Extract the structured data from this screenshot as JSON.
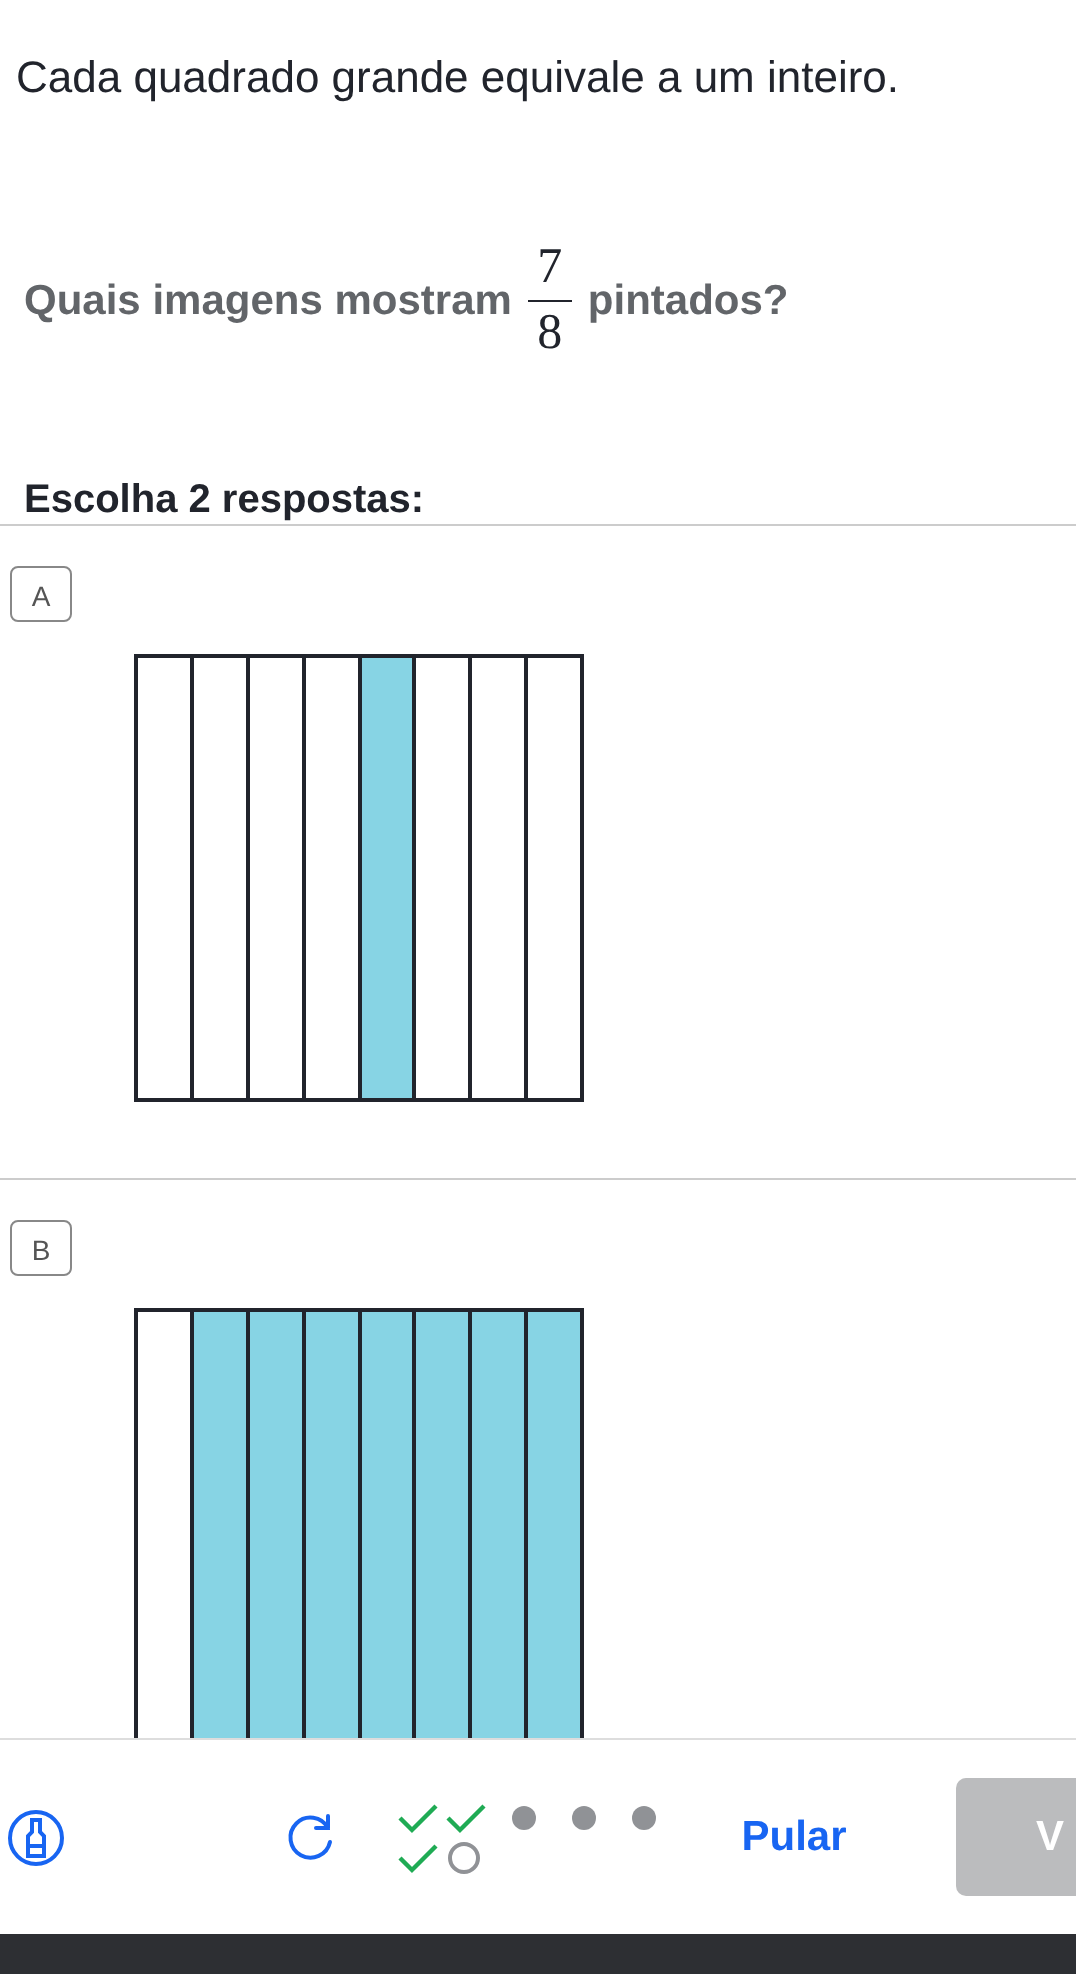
{
  "intro": "Cada quadrado grande equivale a um inteiro.",
  "question": {
    "before": "Quais imagens mostram",
    "numerator": "7",
    "denominator": "8",
    "after": "pintados?"
  },
  "instruction": "Escolha 2 respostas:",
  "options": [
    {
      "letter": "A",
      "columns": [
        {
          "shaded": false
        },
        {
          "shaded": false
        },
        {
          "shaded": false
        },
        {
          "shaded": false
        },
        {
          "shaded": true
        },
        {
          "shaded": false
        },
        {
          "shaded": false
        },
        {
          "shaded": false
        }
      ]
    },
    {
      "letter": "B",
      "columns": [
        {
          "shaded": false
        },
        {
          "shaded": true
        },
        {
          "shaded": true
        },
        {
          "shaded": true
        },
        {
          "shaded": true
        },
        {
          "shaded": true
        },
        {
          "shaded": true
        },
        {
          "shaded": true
        }
      ]
    }
  ],
  "progress_rows": [
    [
      {
        "kind": "correct"
      },
      {
        "kind": "correct"
      },
      {
        "kind": "pending"
      },
      {
        "kind": "pending"
      },
      {
        "kind": "pending"
      }
    ],
    [
      {
        "kind": "correct"
      },
      {
        "kind": "current"
      }
    ]
  ],
  "skip_label": "Pular",
  "check_label": "V"
}
